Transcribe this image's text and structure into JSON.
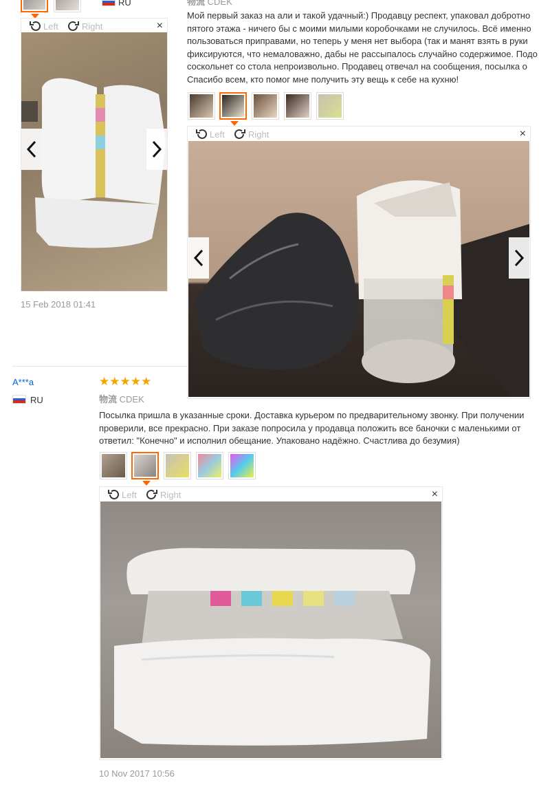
{
  "review1": {
    "country": "RU",
    "date": "15 Feb 2018 01:41",
    "viewer": {
      "left_label": "Left",
      "right_label": "Right",
      "close": "×"
    }
  },
  "review2": {
    "logistics_label": "物流",
    "logistics_value": "CDEK",
    "text_lines": [
      "Мой первый заказ на али и такой удачный:) Продавцу респект, упаковал добротно",
      "пятого этажа - ничего бы с моими милыми коробочками не случилось. Всё именно",
      "пользоваться приправами, но теперь у меня нет выбора (так и манят взять в руки",
      "фиксируются, что немаловажно, дабы не рассыпалось случайно содержимое. Подо",
      "соскольнет со стола непроизвольно. Продавец отвечал на сообщения, посылка о",
      "Спасибо всем, кто помог мне получить эту вещь к себе на кухню!"
    ],
    "viewer": {
      "left_label": "Left",
      "right_label": "Right",
      "close": "×"
    }
  },
  "review3": {
    "username": "A***a",
    "country": "RU",
    "stars": "★★★★★",
    "logistics_label": "物流",
    "logistics_value": "CDEK",
    "text_lines": [
      "Посылка пришла в указанные сроки. Доставка курьером по предварительному звонку. При получении",
      "проверили, все прекрасно. При заказе попросила у продавца положить все баночки с маленькими от",
      "ответил: \"Конечно\" и исполнил обещание. Упаковано надёжно. Счастлива до безумия)"
    ],
    "viewer": {
      "left_label": "Left",
      "right_label": "Right",
      "close": "×"
    },
    "date": "10 Nov 2017 10:56"
  },
  "colors": {
    "accent": "#ff6600",
    "star": "#f7a400",
    "link": "#0066cc"
  }
}
